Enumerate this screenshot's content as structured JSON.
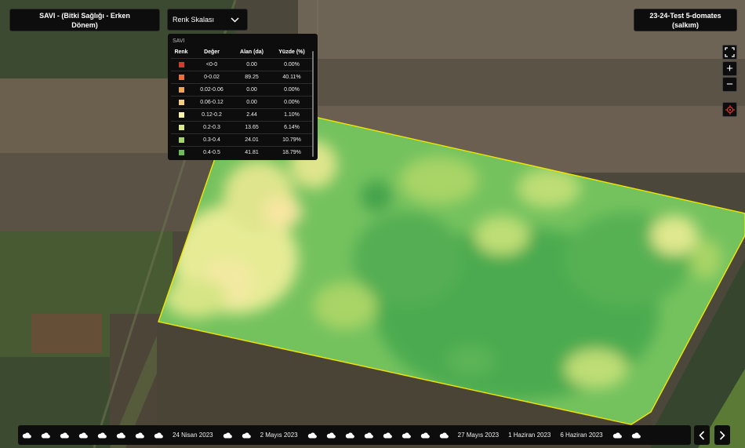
{
  "header": {
    "layer_title_line1": "SAVI - (Bitki Sağlığı - Erken",
    "layer_title_line2": "Dönem)",
    "scale_dropdown_label": "Renk Skalası",
    "field_title_line1": "23-24-Test 5-domates",
    "field_title_line2": "(salkım)"
  },
  "legend": {
    "title": "SAVI",
    "columns": [
      "Renk",
      "Değer",
      "Alan (da)",
      "Yüzde (%)"
    ],
    "rows": [
      {
        "color": "#d9382f",
        "range": "<0-0",
        "area": "0.00",
        "percent": "0.00%"
      },
      {
        "color": "#e8703a",
        "range": "0-0.02",
        "area": "89.25",
        "percent": "40.11%"
      },
      {
        "color": "#f0a35a",
        "range": "0.02-0.06",
        "area": "0.00",
        "percent": "0.00%"
      },
      {
        "color": "#f5cf80",
        "range": "0.06-0.12",
        "area": "0.00",
        "percent": "0.00%"
      },
      {
        "color": "#fbf3a8",
        "range": "0.12-0.2",
        "area": "2.44",
        "percent": "1.10%"
      },
      {
        "color": "#d9e889",
        "range": "0.2-0.3",
        "area": "13.65",
        "percent": "6.14%"
      },
      {
        "color": "#a6d46a",
        "range": "0.3-0.4",
        "area": "24.01",
        "percent": "10.79%"
      },
      {
        "color": "#6cbd5a",
        "range": "0.4-0.5",
        "area": "41.81",
        "percent": "18.79%"
      }
    ]
  },
  "map_controls": {
    "fullscreen_icon": "fullscreen-icon",
    "zoom_in_label": "+",
    "zoom_out_label": "−",
    "locate_icon": "locate-icon"
  },
  "timeline": {
    "items": [
      {
        "type": "icon",
        "icon": "cloud-icon"
      },
      {
        "type": "icon",
        "icon": "cloud-icon"
      },
      {
        "type": "icon",
        "icon": "cloud-icon"
      },
      {
        "type": "icon",
        "icon": "cloud-icon"
      },
      {
        "type": "icon",
        "icon": "cloud-icon"
      },
      {
        "type": "icon",
        "icon": "cloud-icon"
      },
      {
        "type": "icon",
        "icon": "cloud-icon"
      },
      {
        "type": "icon",
        "icon": "cloud-icon"
      },
      {
        "type": "date",
        "label": "24 Nisan 2023"
      },
      {
        "type": "icon",
        "icon": "cloud-icon"
      },
      {
        "type": "icon",
        "icon": "cloud-icon"
      },
      {
        "type": "date",
        "label": "2 Mayıs 2023"
      },
      {
        "type": "icon",
        "icon": "cloud-icon"
      },
      {
        "type": "icon",
        "icon": "cloud-icon"
      },
      {
        "type": "icon",
        "icon": "cloud-icon"
      },
      {
        "type": "icon",
        "icon": "cloud-icon"
      },
      {
        "type": "icon",
        "icon": "cloud-icon"
      },
      {
        "type": "icon",
        "icon": "cloud-icon"
      },
      {
        "type": "icon",
        "icon": "cloud-icon"
      },
      {
        "type": "icon",
        "icon": "cloud-icon"
      },
      {
        "type": "date",
        "label": "27 Mayıs 2023"
      },
      {
        "type": "date",
        "label": "1 Haziran 2023"
      },
      {
        "type": "date",
        "label": "6 Haziran 2023"
      },
      {
        "type": "icon",
        "icon": "cloud-icon"
      },
      {
        "type": "icon",
        "icon": "cloud-icon"
      }
    ],
    "prev_icon": "chevron-left-icon",
    "next_icon": "chevron-right-icon"
  },
  "colors": {
    "field_boundary": "#f2e600",
    "panel_bg": "#0d0d0d",
    "locate_accent": "#d9382f"
  }
}
